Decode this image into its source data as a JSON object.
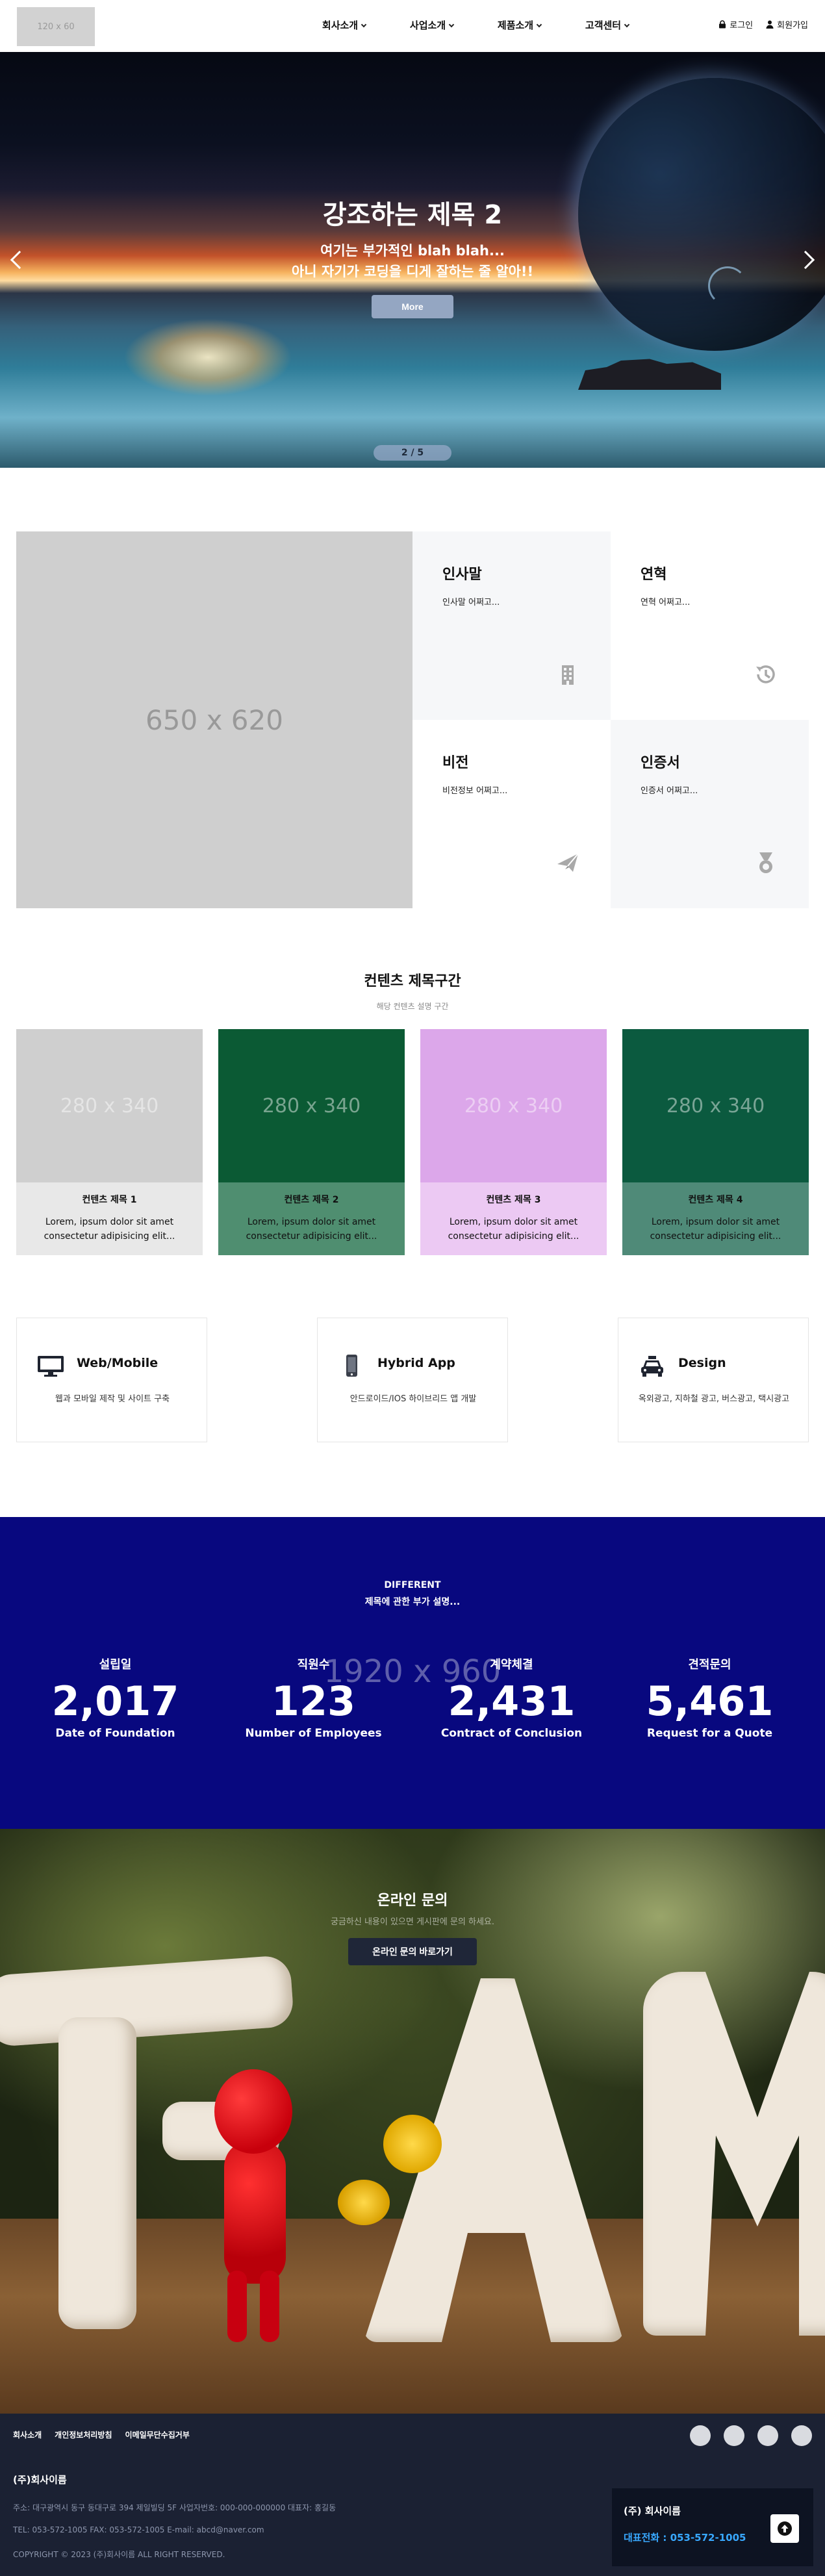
{
  "header": {
    "logo": "120 x 60",
    "nav": [
      "회사소개",
      "사업소개",
      "제품소개",
      "고객센터"
    ],
    "login": "로그인",
    "signup": "회원가입"
  },
  "hero": {
    "title": "강조하는 제목 2",
    "sub1": "여기는 부가적인 blah blah...",
    "sub2": "아니 자기가 코딩을 디게 잘하는 줄 알아!!",
    "button": "More",
    "pager": "2  /  5"
  },
  "about": {
    "image": "650 x 620",
    "cards": [
      {
        "title": "인사말",
        "desc": "인사말 어쩌고..."
      },
      {
        "title": "연혁",
        "desc": "연혁 어쩌고..."
      },
      {
        "title": "비전",
        "desc": "비전정보 어쩌고..."
      },
      {
        "title": "인증서",
        "desc": "인증서 어쩌고..."
      }
    ]
  },
  "contents": {
    "title": "컨텐츠 제목구간",
    "desc": "해당 컨텐츠 설명 구간",
    "cards": [
      {
        "thumb": "280 x 340",
        "title": "컨텐츠 제목 1",
        "desc": "Lorem, ipsum dolor sit amet consectetur adipisicing elit...",
        "color": "#cfcfcf",
        "body_color": "#e8e8e8"
      },
      {
        "thumb": "280 x 340",
        "title": "컨텐츠 제목 2",
        "desc": "Lorem, ipsum dolor sit amet consectetur adipisicing elit...",
        "color": "#0b5a34",
        "body_color": "#4f8e70"
      },
      {
        "thumb": "280 x 340",
        "title": "컨텐츠 제목 3",
        "desc": "Lorem, ipsum dolor sit amet consectetur adipisicing elit...",
        "color": "#dca7ea",
        "body_color": "#ecc9f3"
      },
      {
        "thumb": "280 x 340",
        "title": "컨텐츠 제목 4",
        "desc": "Lorem, ipsum dolor sit amet consectetur adipisicing elit...",
        "color": "#0b5a3f",
        "body_color": "#4f8a78"
      }
    ]
  },
  "services": [
    {
      "icon": "monitor-icon",
      "title": "Web/Mobile",
      "desc": "웹과 모바일 제작 및 사이트 구축"
    },
    {
      "icon": "smartphone-icon",
      "title": "Hybrid App",
      "desc": "안드로이드/IOS 하이브리드 앱 개발"
    },
    {
      "icon": "taxi-icon",
      "title": "Design",
      "desc": "옥외광고, 지하철 광고, 버스광고, 택시광고"
    }
  ],
  "stats": {
    "bg_placeholder": "1920 x 960",
    "kicker": "DIFFERENT",
    "subtitle": "제목에 관한 부가 설명...",
    "items": [
      {
        "label": "설립일",
        "value": "2,017",
        "en": "Date of Foundation"
      },
      {
        "label": "직원수",
        "value": "123",
        "en": "Number of Employees"
      },
      {
        "label": "계약체결",
        "value": "2,431",
        "en": "Contract of Conclusion"
      },
      {
        "label": "견적문의",
        "value": "5,461",
        "en": "Request for a Quote"
      }
    ]
  },
  "inquiry": {
    "title": "온라인 문의",
    "desc": "궁금하신 내용이 있으면 게시판에 문의 하세요.",
    "button": "온라인 문의 바로가기"
  },
  "footer": {
    "links": [
      "회사소개",
      "개인정보처리방침",
      "이메일무단수집거부"
    ],
    "company": "(주)회사이름",
    "address": "주소: 대구광역시 동구 동대구로 394 제일빌딩 5F   사업자번호: 000-000-000000   대표자: 홍길동",
    "contact": "TEL: 053-572-1005   FAX: 053-572-1005   E-mail: abcd@naver.com",
    "copyright": "COPYRIGHT © 2023 (주)회사이름 ALL RIGHT RESERVED.",
    "box_name": "(주) 회사이름",
    "box_phone": "대표전화 : 053-572-1005"
  }
}
